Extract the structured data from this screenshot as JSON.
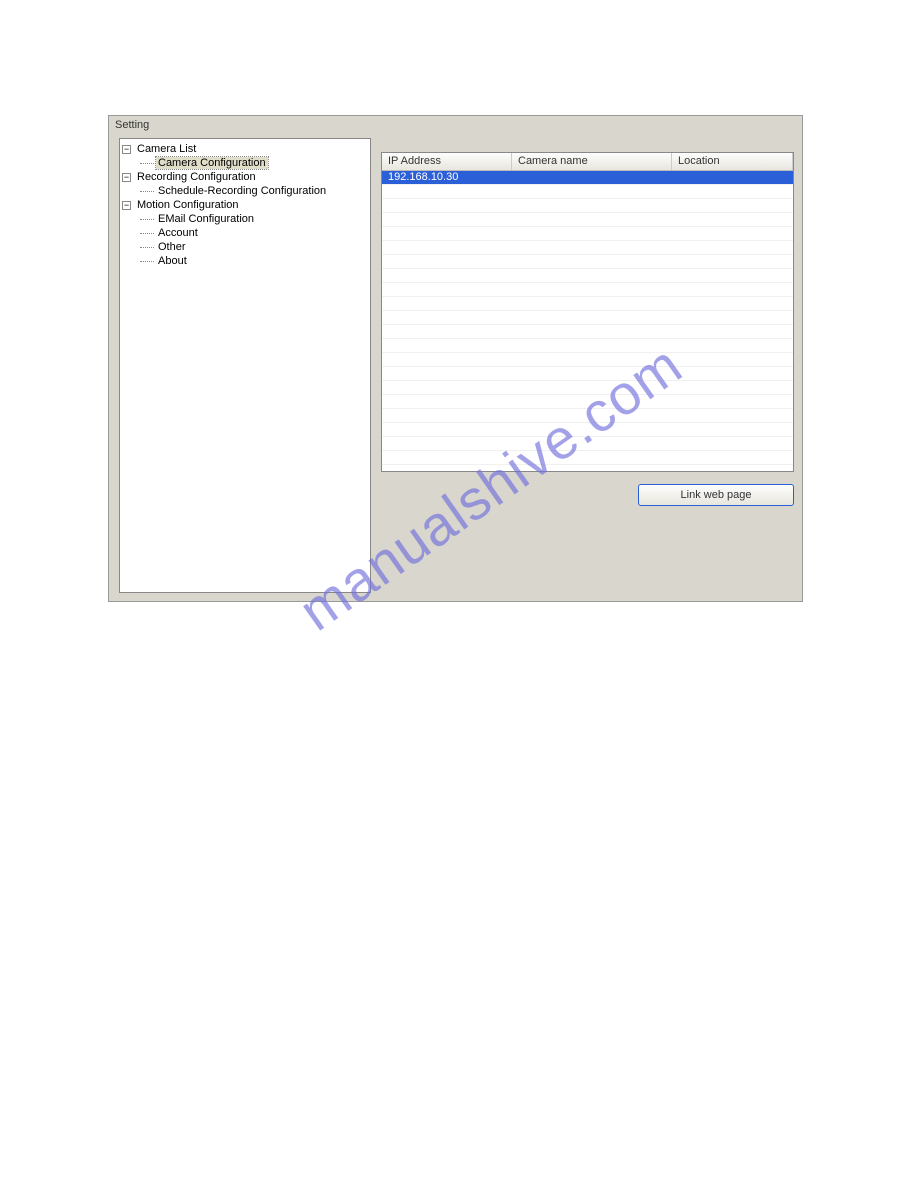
{
  "window": {
    "title": "Setting"
  },
  "tree": {
    "items": [
      {
        "label": "Camera List",
        "expandable": true,
        "expanded": true
      },
      {
        "label": "Camera Configuration",
        "child": true,
        "selected": true
      },
      {
        "label": "Recording Configuration",
        "expandable": true,
        "expanded": true
      },
      {
        "label": "Schedule-Recording Configuration",
        "child": true
      },
      {
        "label": "Motion Configuration",
        "expandable": true,
        "expanded": true
      },
      {
        "label": "EMail Configuration",
        "child": true
      },
      {
        "label": "Account",
        "leaf": true
      },
      {
        "label": "Other",
        "leaf": true
      },
      {
        "label": "About",
        "leaf": true
      }
    ]
  },
  "table": {
    "headers": {
      "ip": "IP Address",
      "name": "Camera name",
      "location": "Location"
    },
    "rows": [
      {
        "ip": "192.168.10.30",
        "name": "",
        "location": "",
        "selected": true
      }
    ],
    "empty_row_count": 20
  },
  "buttons": {
    "link_web_page": "Link web page"
  },
  "watermark": "manualshive.com"
}
